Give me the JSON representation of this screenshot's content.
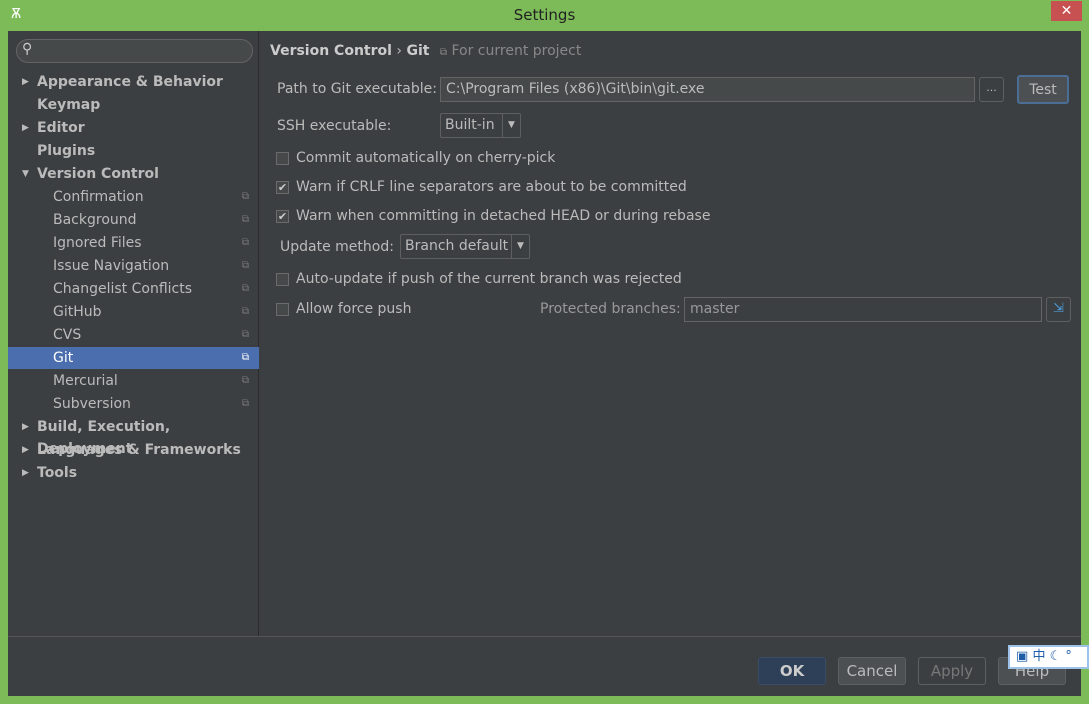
{
  "window": {
    "title": "Settings",
    "close": "✕"
  },
  "search": {
    "placeholder": ""
  },
  "sidebar": {
    "items": [
      {
        "label": "Appearance & Behavior",
        "level": 0,
        "expandable": true
      },
      {
        "label": "Keymap",
        "level": 0
      },
      {
        "label": "Editor",
        "level": 0,
        "expandable": true
      },
      {
        "label": "Plugins",
        "level": 0
      },
      {
        "label": "Version Control",
        "level": 0,
        "expanded": true
      },
      {
        "label": "Confirmation",
        "level": 1
      },
      {
        "label": "Background",
        "level": 1
      },
      {
        "label": "Ignored Files",
        "level": 1
      },
      {
        "label": "Issue Navigation",
        "level": 1
      },
      {
        "label": "Changelist Conflicts",
        "level": 1
      },
      {
        "label": "GitHub",
        "level": 1
      },
      {
        "label": "CVS",
        "level": 1
      },
      {
        "label": "Git",
        "level": 1,
        "selected": true
      },
      {
        "label": "Mercurial",
        "level": 1
      },
      {
        "label": "Subversion",
        "level": 1
      },
      {
        "label": "Build, Execution, Deployment",
        "level": 0,
        "expandable": true
      },
      {
        "label": "Languages & Frameworks",
        "level": 0,
        "expandable": true
      },
      {
        "label": "Tools",
        "level": 0,
        "expandable": true
      }
    ]
  },
  "breadcrumb": {
    "parent": "Version Control",
    "sep": "›",
    "current": "Git",
    "hint": "For current project"
  },
  "git": {
    "path_label": "Path to Git executable:",
    "path_value": "C:\\Program Files (x86)\\Git\\bin\\git.exe",
    "browse": "...",
    "test": "Test",
    "ssh_label": "SSH executable:",
    "ssh_value": "Built-in",
    "commit_cherry": {
      "label": "Commit automatically on cherry-pick",
      "checked": false
    },
    "warn_crlf": {
      "label": "Warn if CRLF line separators are about to be committed",
      "checked": true
    },
    "warn_detached": {
      "label": "Warn when committing in detached HEAD or during rebase",
      "checked": true
    },
    "update_label": "Update method:",
    "update_value": "Branch default",
    "auto_update": {
      "label": "Auto-update if push of the current branch was rejected",
      "checked": false
    },
    "force_push": {
      "label": "Allow force push",
      "checked": false
    },
    "protected_label": "Protected branches:",
    "protected_value": "master"
  },
  "footer": {
    "ok": "OK",
    "cancel": "Cancel",
    "apply": "Apply",
    "help": "Help"
  },
  "ime": {
    "text": "中"
  }
}
